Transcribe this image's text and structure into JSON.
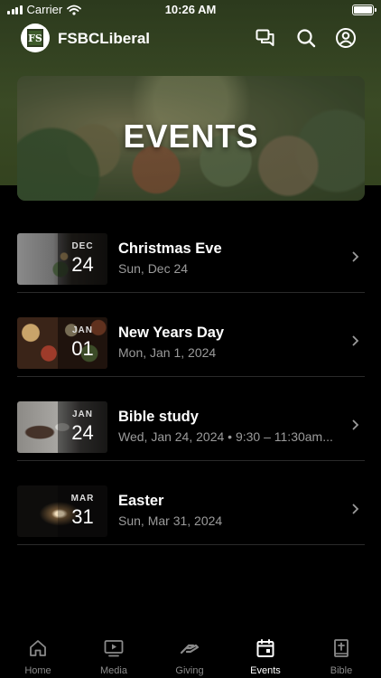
{
  "status_bar": {
    "carrier": "Carrier",
    "time": "10:26 AM"
  },
  "header": {
    "title": "FSBCLiberal",
    "logo_letters": "FS"
  },
  "banner": {
    "title": "EVENTS"
  },
  "events": [
    {
      "month": "DEC",
      "day": "24",
      "title": "Christmas Eve",
      "subtitle": "Sun, Dec 24"
    },
    {
      "month": "JAN",
      "day": "01",
      "title": "New Years Day",
      "subtitle": "Mon, Jan 1, 2024"
    },
    {
      "month": "JAN",
      "day": "24",
      "title": "Bible study",
      "subtitle": "Wed, Jan 24, 2024 • 9:30 – 11:30am..."
    },
    {
      "month": "MAR",
      "day": "31",
      "title": "Easter",
      "subtitle": "Sun, Mar 31, 2024"
    }
  ],
  "tabs": [
    {
      "label": "Home",
      "icon": "home-icon"
    },
    {
      "label": "Media",
      "icon": "media-icon"
    },
    {
      "label": "Giving",
      "icon": "giving-icon"
    },
    {
      "label": "Events",
      "icon": "calendar-icon"
    },
    {
      "label": "Bible",
      "icon": "bible-icon"
    }
  ],
  "colors": {
    "header_bg": "#3a4a25",
    "background": "#000000",
    "muted_text": "#9b9b9b",
    "active_tab": "#ffffff",
    "inactive_tab": "#8a8a8a"
  }
}
